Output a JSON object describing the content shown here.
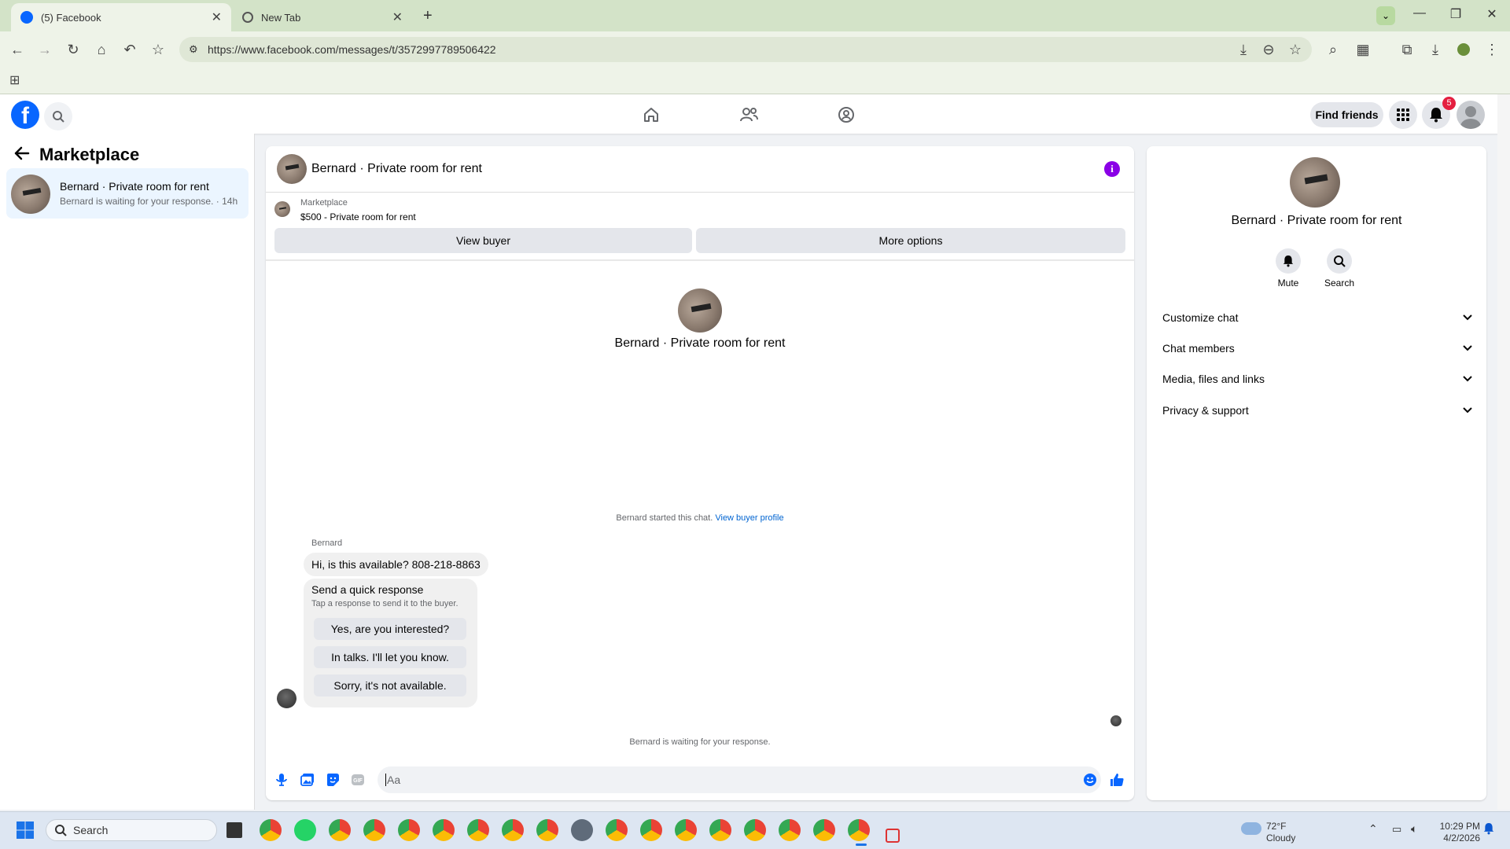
{
  "browser": {
    "tabs": [
      {
        "title": "(5) Facebook",
        "active": true,
        "icon": "facebook-icon"
      },
      {
        "title": "New Tab",
        "active": false,
        "icon": "globe-icon"
      }
    ],
    "url": "https://www.facebook.com/messages/t/3572997789506422"
  },
  "fb_header": {
    "logo": "f",
    "find_friends_label": "Find friends",
    "notification_count": "5"
  },
  "left_panel": {
    "title": "Marketplace",
    "conversations": [
      {
        "name": "Bernard · Private room for rent",
        "preview": "Bernard is waiting for your response. · 14h"
      }
    ]
  },
  "chat": {
    "header_name": "Bernard · Private room for rent",
    "marketplace_label": "Marketplace",
    "listing": "$500 - Private room for rent",
    "view_buyer_label": "View buyer",
    "more_options_label": "More options",
    "center_name": "Bernard · Private room for rent",
    "started_text": "Bernard started this chat.",
    "view_buyer_profile_link": "View buyer profile",
    "sender_name": "Bernard",
    "message": "Hi, is this available? 808-218-8863",
    "quick_title": "Send a quick response",
    "quick_subtitle": "Tap a response to send it to the buyer.",
    "quick_responses": [
      "Yes, are you interested?",
      "In talks. I'll let you know.",
      "Sorry, it's not available."
    ],
    "waiting_text": "Bernard is waiting for your response.",
    "composer_placeholder": "Aa"
  },
  "right_panel": {
    "name": "Bernard · Private room for rent",
    "mute_label": "Mute",
    "search_label": "Search",
    "sections": [
      "Customize chat",
      "Chat members",
      "Media, files and links",
      "Privacy & support"
    ]
  },
  "taskbar": {
    "search_placeholder": "Search",
    "weather_temp": "72°F",
    "weather_desc": "Cloudy",
    "time": "10:29 PM",
    "date": "4/2/2026"
  },
  "colors": {
    "fb_blue": "#0866ff",
    "info_purple": "#8a00e6",
    "badge_red": "#e41e3f",
    "link_blue": "#0064d1",
    "tabbar_green": "#d3e3c8"
  }
}
